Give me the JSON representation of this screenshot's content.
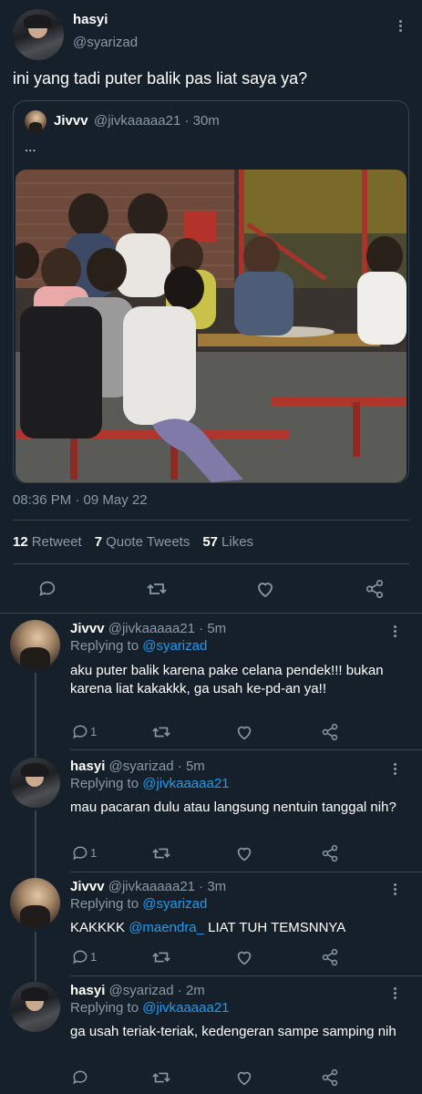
{
  "main_tweet": {
    "author_name": "hasyi",
    "author_handle": "@syarizad",
    "text": "ini yang tadi puter balik pas liat saya ya?",
    "quote": {
      "author_name": "Jivvv",
      "author_handle": "@jivkaaaaa21 · 30m",
      "text": "..."
    },
    "timestamp": "08:36 PM · 09 May 22",
    "stats": {
      "retweets_count": "12",
      "retweets_label": "Retweet",
      "quotes_count": "7",
      "quotes_label": "Quote Tweets",
      "likes_count": "57",
      "likes_label": "Likes"
    }
  },
  "replies": [
    {
      "author_name": "Jivvv",
      "meta": "@jivkaaaaa21 · 5m",
      "replying_label": "Replying to",
      "replying_to": "@syarizad",
      "text": "aku puter balik karena pake celana pendek!!! bukan karena liat kakakkk, ga usah ke-pd-an ya!!",
      "reply_count": "1"
    },
    {
      "author_name": "hasyi",
      "meta": "@syarizad · 5m",
      "replying_label": "Replying to",
      "replying_to": "@jivkaaaaa21",
      "text": "mau pacaran dulu atau langsung nentuin tanggal nih?",
      "reply_count": "1"
    },
    {
      "author_name": "Jivvv",
      "meta": "@jivkaaaaa21 · 3m",
      "replying_label": "Replying to",
      "replying_to": "@syarizad",
      "text_before": "KAKKKK ",
      "mention": "@maendra_",
      "text_after": " LIAT TUH TEMSNNYA",
      "reply_count": "1"
    },
    {
      "author_name": "hasyi",
      "meta": "@syarizad · 2m",
      "replying_label": "Replying to",
      "replying_to": "@jivkaaaaa21",
      "text": "ga usah teriak-teriak, kedengeran sampe samping nih",
      "reply_count": ""
    }
  ],
  "icons": [
    "more-icon",
    "reply-icon",
    "retweet-icon",
    "like-icon",
    "share-icon"
  ],
  "colors": {
    "background": "#15202b",
    "border": "#38444d",
    "muted": "#8b98a5",
    "accent": "#1d9bf0"
  }
}
